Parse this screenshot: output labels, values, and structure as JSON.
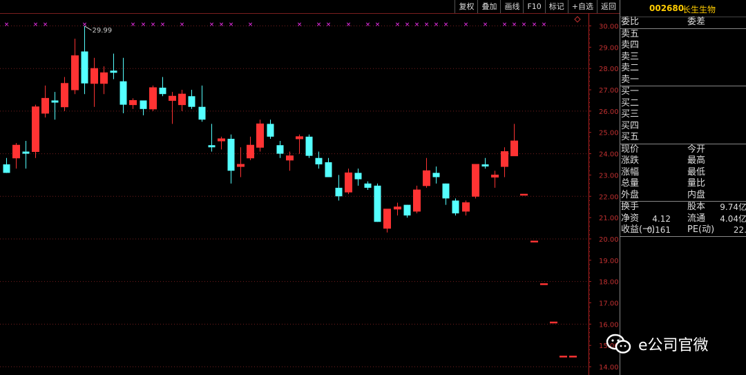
{
  "toolbar": {
    "buttons": [
      "复权",
      "叠加",
      "画线",
      "F10",
      "标记",
      "+自选",
      "返回"
    ]
  },
  "stock": {
    "code": "002680",
    "name": "长生生物"
  },
  "panel": {
    "weibi_label": "委比",
    "weicha_label": "委差",
    "sell_labels": [
      "卖五",
      "卖四",
      "卖三",
      "卖二",
      "卖一"
    ],
    "buy_labels": [
      "买一",
      "买二",
      "买三",
      "买四",
      "买五"
    ],
    "quote_rows": [
      {
        "left": "现价",
        "mid": "今开"
      },
      {
        "left": "涨跌",
        "mid": "最高"
      },
      {
        "left": "涨幅",
        "mid": "最低"
      },
      {
        "left": "总量",
        "mid": "量比"
      },
      {
        "left": "外盘",
        "mid": "内盘"
      }
    ],
    "fin_rows": [
      {
        "left": "换手",
        "val1": "",
        "mid": "股本",
        "val2": "9.74亿"
      },
      {
        "left": "净资",
        "val1": "4.12",
        "mid": "流通",
        "val2": "4.04亿"
      },
      {
        "left": "收益(一)",
        "val1": "0.161",
        "mid": "PE(动)",
        "val2": "22."
      }
    ]
  },
  "watermark": {
    "text": "e公司官微"
  },
  "colors": {
    "up": "#ff3333",
    "down": "#54ffff",
    "axis": "#c03030",
    "marker": "#ff33ff",
    "background": "#000000"
  },
  "chart_data": {
    "type": "candlestick",
    "ylim": [
      13.8,
      30.25
    ],
    "yticks": [
      14,
      15,
      16,
      17,
      18,
      19,
      20,
      21,
      22,
      23,
      24,
      25,
      26,
      27,
      28,
      29,
      30
    ],
    "ytick_labels": [
      "14.00",
      "15.00",
      "16.00",
      "17.00",
      "18.00",
      "19.00",
      "20.00",
      "21.00",
      "22.00",
      "23.00",
      "24.00",
      "25.00",
      "26.00",
      "27.00",
      "28.00",
      "29.00",
      "30.00"
    ],
    "max_annotation": {
      "value": 29.99,
      "label": "29.99"
    },
    "candles": [
      {
        "o": 23.5,
        "h": 23.8,
        "l": 23.1,
        "c": 23.1
      },
      {
        "o": 23.8,
        "h": 24.5,
        "l": 23.3,
        "c": 24.4
      },
      {
        "o": 24.1,
        "h": 24.6,
        "l": 23.3,
        "c": 24.0
      },
      {
        "o": 24.1,
        "h": 26.3,
        "l": 23.8,
        "c": 26.2
      },
      {
        "o": 25.9,
        "h": 27.2,
        "l": 25.7,
        "c": 26.6
      },
      {
        "o": 26.5,
        "h": 26.9,
        "l": 25.6,
        "c": 26.4
      },
      {
        "o": 26.2,
        "h": 27.6,
        "l": 26.0,
        "c": 27.3
      },
      {
        "o": 27.0,
        "h": 29.4,
        "l": 26.8,
        "c": 28.6
      },
      {
        "o": 28.8,
        "h": 29.99,
        "l": 26.8,
        "c": 27.3
      },
      {
        "o": 27.3,
        "h": 28.5,
        "l": 26.2,
        "c": 28.0
      },
      {
        "o": 27.3,
        "h": 28.1,
        "l": 26.8,
        "c": 27.8
      },
      {
        "o": 27.9,
        "h": 28.7,
        "l": 27.5,
        "c": 27.8
      },
      {
        "o": 27.4,
        "h": 28.5,
        "l": 25.9,
        "c": 26.3
      },
      {
        "o": 26.3,
        "h": 26.6,
        "l": 26.1,
        "c": 26.5
      },
      {
        "o": 26.5,
        "h": 26.5,
        "l": 25.8,
        "c": 26.1
      },
      {
        "o": 26.1,
        "h": 27.2,
        "l": 26.0,
        "c": 27.1
      },
      {
        "o": 27.1,
        "h": 27.6,
        "l": 26.7,
        "c": 26.8
      },
      {
        "o": 26.5,
        "h": 26.9,
        "l": 25.4,
        "c": 26.7
      },
      {
        "o": 26.3,
        "h": 27.0,
        "l": 26.0,
        "c": 26.8
      },
      {
        "o": 26.7,
        "h": 27.0,
        "l": 26.1,
        "c": 26.2
      },
      {
        "o": 26.2,
        "h": 27.2,
        "l": 25.5,
        "c": 25.6
      },
      {
        "o": 24.4,
        "h": 25.4,
        "l": 24.1,
        "c": 24.3
      },
      {
        "o": 24.6,
        "h": 24.8,
        "l": 24.2,
        "c": 24.7
      },
      {
        "o": 24.7,
        "h": 24.9,
        "l": 22.6,
        "c": 23.2
      },
      {
        "o": 23.4,
        "h": 24.3,
        "l": 22.9,
        "c": 23.5
      },
      {
        "o": 23.8,
        "h": 24.8,
        "l": 23.7,
        "c": 24.4
      },
      {
        "o": 24.3,
        "h": 25.6,
        "l": 24.1,
        "c": 25.4
      },
      {
        "o": 25.4,
        "h": 25.6,
        "l": 24.7,
        "c": 24.8
      },
      {
        "o": 24.4,
        "h": 24.6,
        "l": 23.8,
        "c": 24.0
      },
      {
        "o": 23.7,
        "h": 24.1,
        "l": 23.2,
        "c": 23.9
      },
      {
        "o": 24.7,
        "h": 24.9,
        "l": 24.0,
        "c": 24.8
      },
      {
        "o": 24.8,
        "h": 24.9,
        "l": 23.8,
        "c": 23.9
      },
      {
        "o": 23.8,
        "h": 24.1,
        "l": 23.3,
        "c": 23.5
      },
      {
        "o": 23.6,
        "h": 23.8,
        "l": 22.9,
        "c": 22.9
      },
      {
        "o": 22.4,
        "h": 23.0,
        "l": 21.8,
        "c": 22.0
      },
      {
        "o": 22.2,
        "h": 23.3,
        "l": 22.1,
        "c": 23.1
      },
      {
        "o": 23.1,
        "h": 23.3,
        "l": 22.5,
        "c": 22.8
      },
      {
        "o": 22.6,
        "h": 22.7,
        "l": 22.3,
        "c": 22.4
      },
      {
        "o": 22.5,
        "h": 22.6,
        "l": 20.8,
        "c": 20.8
      },
      {
        "o": 20.5,
        "h": 21.4,
        "l": 20.3,
        "c": 21.4
      },
      {
        "o": 21.4,
        "h": 21.7,
        "l": 21.1,
        "c": 21.5
      },
      {
        "o": 21.6,
        "h": 21.6,
        "l": 21.0,
        "c": 21.1
      },
      {
        "o": 21.3,
        "h": 22.5,
        "l": 21.2,
        "c": 22.3
      },
      {
        "o": 22.5,
        "h": 23.8,
        "l": 22.4,
        "c": 23.2
      },
      {
        "o": 23.1,
        "h": 23.4,
        "l": 22.6,
        "c": 22.9
      },
      {
        "o": 22.6,
        "h": 22.6,
        "l": 21.6,
        "c": 21.9
      },
      {
        "o": 21.8,
        "h": 21.9,
        "l": 21.1,
        "c": 21.2
      },
      {
        "o": 21.3,
        "h": 21.8,
        "l": 21.1,
        "c": 21.7
      },
      {
        "o": 22.0,
        "h": 23.5,
        "l": 21.9,
        "c": 23.5
      },
      {
        "o": 23.5,
        "h": 23.8,
        "l": 23.3,
        "c": 23.4
      },
      {
        "o": 22.9,
        "h": 23.2,
        "l": 22.4,
        "c": 23.0
      },
      {
        "o": 23.4,
        "h": 24.3,
        "l": 22.9,
        "c": 24.1
      },
      {
        "o": 23.9,
        "h": 25.4,
        "l": 23.9,
        "c": 24.6
      },
      {
        "o": 22.1,
        "h": 22.1,
        "l": 22.1,
        "c": 22.1
      },
      {
        "o": 19.9,
        "h": 19.9,
        "l": 19.9,
        "c": 19.9
      },
      {
        "o": 17.9,
        "h": 17.9,
        "l": 17.9,
        "c": 17.9
      },
      {
        "o": 16.1,
        "h": 16.1,
        "l": 16.1,
        "c": 16.1
      },
      {
        "o": 14.5,
        "h": 14.5,
        "l": 14.5,
        "c": 14.5
      },
      {
        "o": 14.5,
        "h": 14.5,
        "l": 14.5,
        "c": 14.5
      }
    ],
    "marker_rows": [
      {
        "symbol": "×",
        "candles": [
          0,
          3,
          4,
          8,
          13,
          14,
          15,
          16,
          18,
          21,
          22,
          23,
          25,
          30,
          32,
          33,
          35,
          37,
          38,
          40,
          41,
          42,
          43,
          44,
          45,
          47,
          49,
          51,
          52,
          53,
          54,
          55
        ]
      }
    ]
  }
}
